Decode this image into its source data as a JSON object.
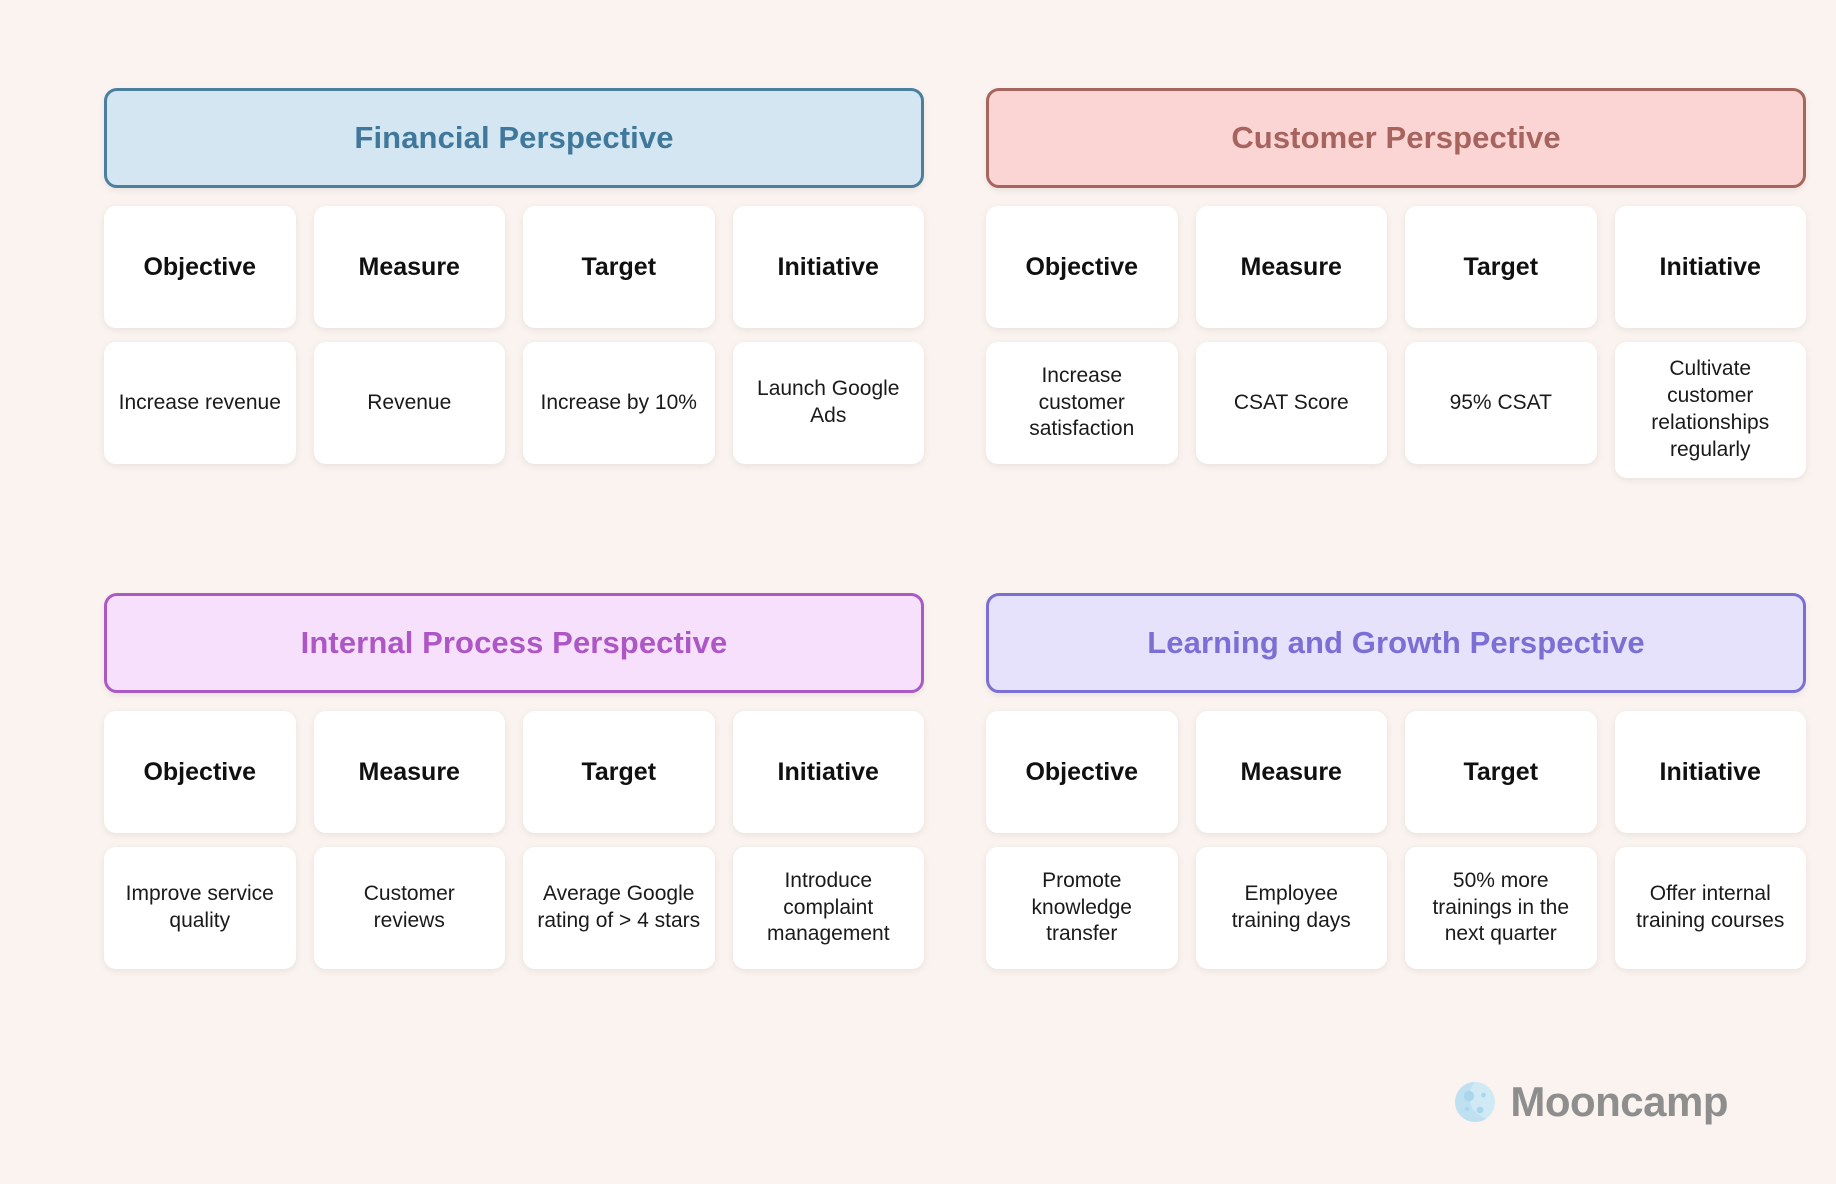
{
  "columns": [
    "Objective",
    "Measure",
    "Target",
    "Initiative"
  ],
  "quadrants": [
    {
      "title": "Financial Perspective",
      "theme": "financial",
      "colors": {
        "bg": "#d4e6f1",
        "border": "#4a7f9e",
        "text": "#40789b"
      },
      "values": [
        "Increase revenue",
        "Revenue",
        "Increase by 10%",
        "Launch Google Ads"
      ]
    },
    {
      "title": "Customer Perspective",
      "theme": "customer",
      "colors": {
        "bg": "#fbd5d3",
        "border": "#a6655f",
        "text": "#a7635e"
      },
      "values": [
        "Increase customer satisfaction",
        "CSAT Score",
        "95% CSAT",
        "Cultivate customer relationships regularly"
      ]
    },
    {
      "title": "Internal Process Perspective",
      "theme": "internal",
      "colors": {
        "bg": "#f7e0fb",
        "border": "#ab59c4",
        "text": "#ad57c6"
      },
      "values": [
        "Improve service quality",
        "Customer reviews",
        "Average Google rating of > 4 stars",
        "Introduce complaint management"
      ]
    },
    {
      "title": "Learning and Growth Perspective",
      "theme": "learning",
      "colors": {
        "bg": "#e6e2fb",
        "border": "#7a6fd4",
        "text": "#7b6fd6"
      },
      "values": [
        "Promote knowledge transfer",
        "Employee training days",
        "50% more trainings in the next quarter",
        "Offer internal training courses"
      ]
    }
  ],
  "brand": {
    "name": "Mooncamp",
    "logo_icon": "moon-icon",
    "logo_color": "#b8dff0",
    "text_color": "#8e8e8e"
  },
  "page": {
    "background": "#faf3ef",
    "card_background": "#ffffff"
  }
}
